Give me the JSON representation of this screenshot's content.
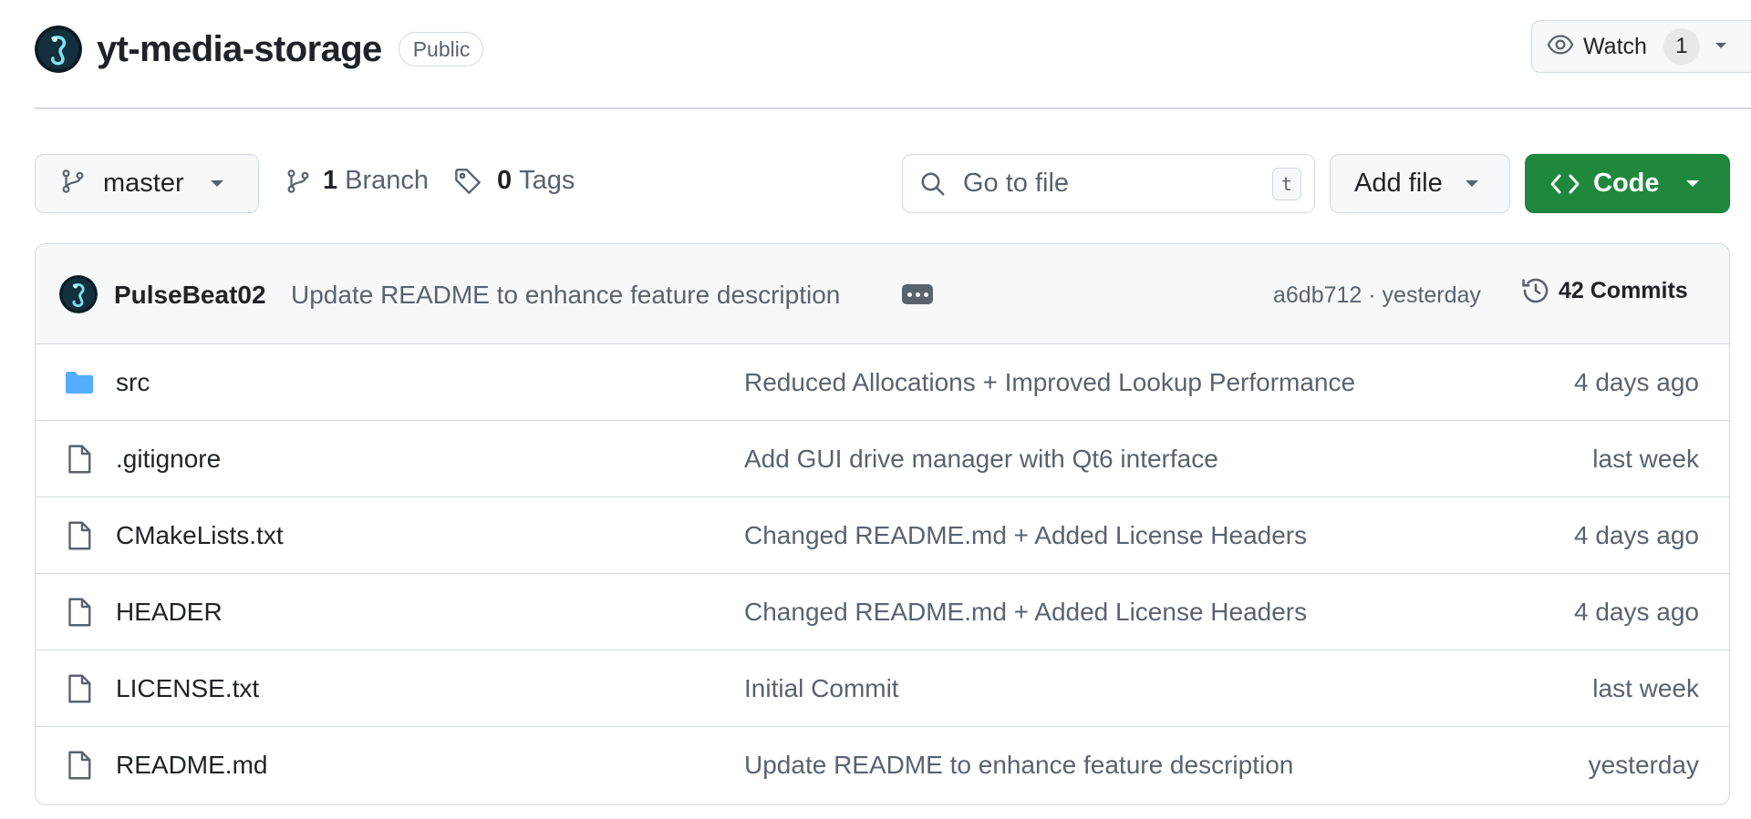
{
  "repo": {
    "name": "yt-media-storage",
    "visibility": "Public"
  },
  "watch": {
    "label": "Watch",
    "count": "1"
  },
  "toolbar": {
    "branch": "master",
    "branch_count": "1",
    "branch_label": "Branch",
    "tag_count": "0",
    "tag_label": "Tags",
    "goto_placeholder": "Go to file",
    "goto_shortcut": "t",
    "add_file_label": "Add file",
    "code_label": "Code"
  },
  "latest_commit": {
    "author": "PulseBeat02",
    "message": "Update README to enhance feature description",
    "sha_and_time": "a6db712 · yesterday",
    "commits_label": "42 Commits"
  },
  "files": [
    {
      "type": "folder",
      "name": "src",
      "message": "Reduced Allocations + Improved Lookup Performance",
      "date": "4 days ago"
    },
    {
      "type": "file",
      "name": ".gitignore",
      "message": "Add GUI drive manager with Qt6 interface",
      "date": "last week"
    },
    {
      "type": "file",
      "name": "CMakeLists.txt",
      "message": "Changed README.md + Added License Headers",
      "date": "4 days ago"
    },
    {
      "type": "file",
      "name": "HEADER",
      "message": "Changed README.md + Added License Headers",
      "date": "4 days ago"
    },
    {
      "type": "file",
      "name": "LICENSE.txt",
      "message": "Initial Commit",
      "date": "last week"
    },
    {
      "type": "file",
      "name": "README.md",
      "message": "Update README to enhance feature description",
      "date": "yesterday"
    }
  ],
  "colors": {
    "primary_button": "#1f883d",
    "folder_icon": "#54aeff",
    "muted_text": "#59636e",
    "border": "#d1d9e0"
  }
}
